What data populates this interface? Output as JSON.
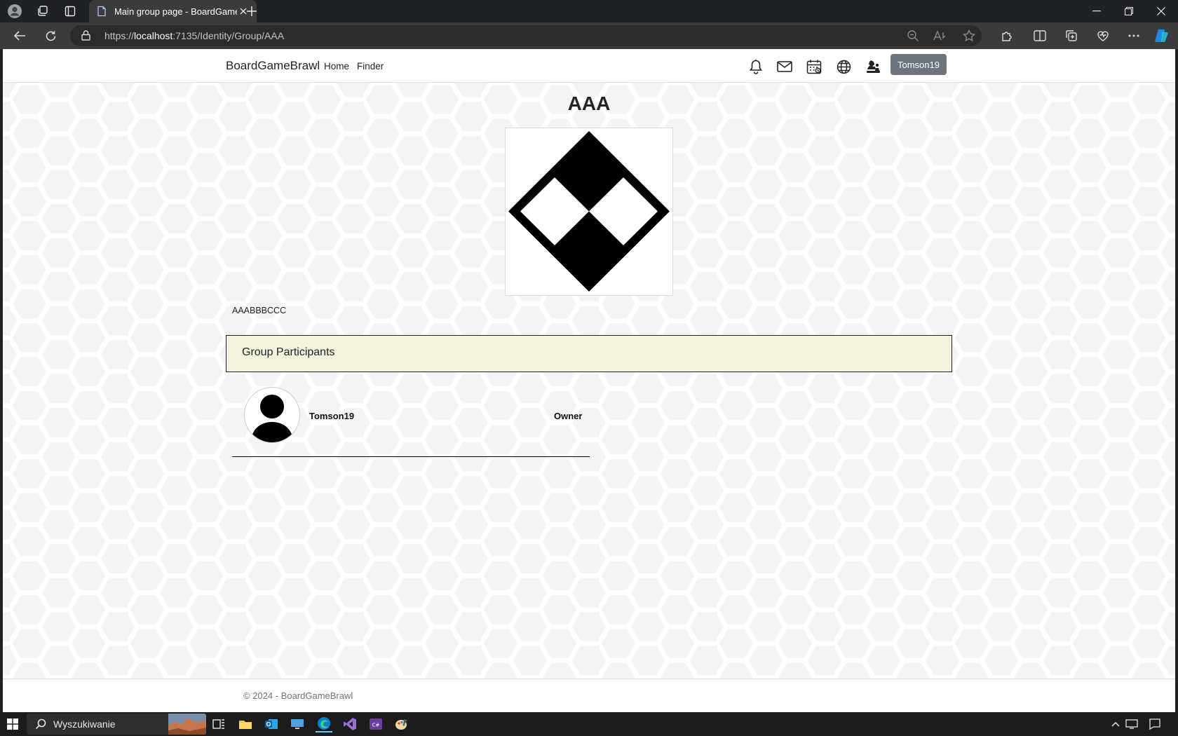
{
  "browser": {
    "tab_title": "Main group page - BoardGameBrawl",
    "url_prefix": "https://",
    "url_host": "localhost",
    "url_path": ":7135/Identity/Group/AAA"
  },
  "navbar": {
    "brand": "BoardGameBrawl",
    "links": [
      "Home",
      "Finder"
    ],
    "user_button": "Tomson19"
  },
  "group": {
    "title": "AAA",
    "description": "AAABBBCCC",
    "participants_header": "Group Participants",
    "participants": [
      {
        "name": "Tomson19",
        "role": "Owner"
      }
    ]
  },
  "footer": {
    "copyright": "© 2024 - BoardGameBrawl"
  },
  "taskbar": {
    "search_placeholder": "Wyszukiwanie"
  },
  "colors": {
    "participants_header_bg": "#f3f2dc",
    "user_button_bg": "#6c757d",
    "browser_frame": "#202124"
  }
}
